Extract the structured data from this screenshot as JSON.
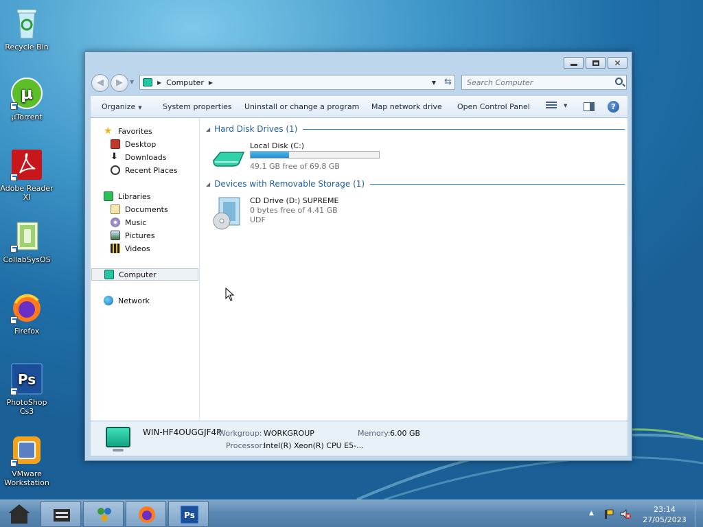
{
  "desktop": {
    "icons": [
      {
        "label": "Recycle Bin",
        "icon": "recycle-bin-icon"
      },
      {
        "label": "µTorrent",
        "icon": "utorrent-icon"
      },
      {
        "label": "Adobe Reader XI",
        "icon": "adobe-reader-icon"
      },
      {
        "label": "CollabSysOS",
        "icon": "collabsysos-icon"
      },
      {
        "label": "Firefox",
        "icon": "firefox-icon"
      },
      {
        "label": "PhotoShop Cs3",
        "icon": "photoshop-icon"
      },
      {
        "label": "VMware Workstation",
        "icon": "vmware-icon"
      }
    ]
  },
  "window": {
    "controls": {
      "minimize": "minimize-icon",
      "maximize": "maximize-icon",
      "close": "close-icon"
    },
    "address": {
      "crumb": "Computer"
    },
    "search": {
      "placeholder": "Search Computer"
    },
    "toolbar": {
      "organize": "Organize",
      "system_properties": "System properties",
      "uninstall": "Uninstall or change a program",
      "map_drive": "Map network drive",
      "control_panel": "Open Control Panel"
    },
    "nav": {
      "favorites": "Favorites",
      "desktop": "Desktop",
      "downloads": "Downloads",
      "recent": "Recent Places",
      "libraries": "Libraries",
      "documents": "Documents",
      "music": "Music",
      "pictures": "Pictures",
      "videos": "Videos",
      "computer": "Computer",
      "network": "Network"
    },
    "groups": {
      "hdd": {
        "title": "Hard Disk Drives (1)",
        "drives": [
          {
            "name": "Local Disk (C:)",
            "free": "49.1 GB free of 69.8 GB",
            "used_fraction": 0.3
          }
        ]
      },
      "removable": {
        "title": "Devices with Removable Storage (1)",
        "drives": [
          {
            "name": "CD Drive (D:) SUPREME",
            "free": "0 bytes free of 4.41 GB",
            "fs": "UDF"
          }
        ]
      }
    },
    "details": {
      "computer_name": "WIN-HF4OUGGJF4P",
      "workgroup_label": "Workgroup:",
      "workgroup": "WORKGROUP",
      "memory_label": "Memory:",
      "memory": "6.00 GB",
      "processor_label": "Processor:",
      "processor": "Intel(R) Xeon(R) CPU E5-..."
    }
  },
  "taskbar": {
    "clock_time": "23:14",
    "clock_date": "27/05/2023"
  },
  "colors": {
    "accent": "#2f7bbf",
    "group_title": "#1e5f9e",
    "progress": "#1e8fd6"
  }
}
